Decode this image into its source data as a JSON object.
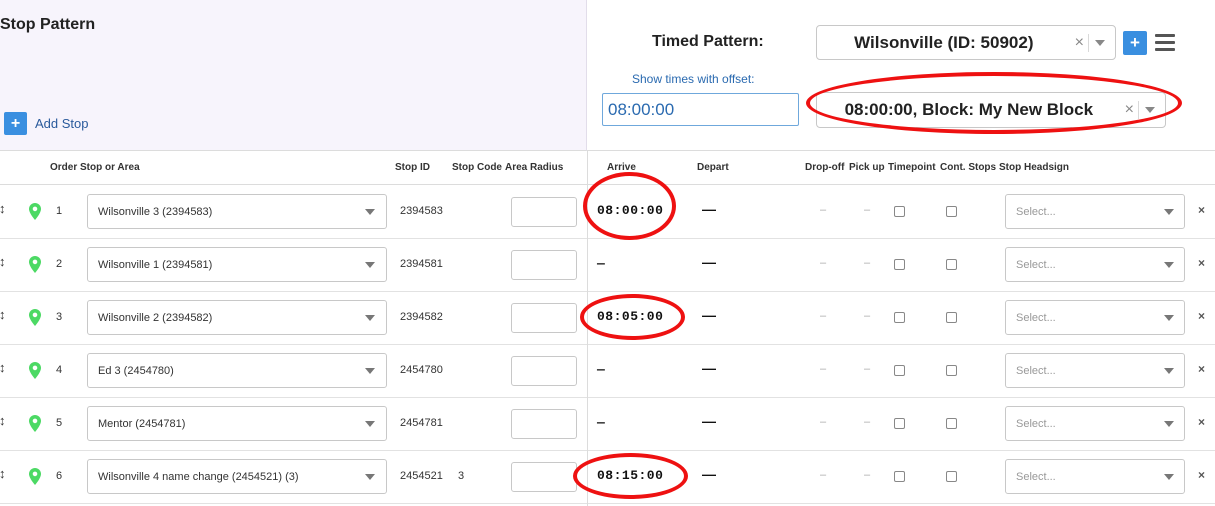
{
  "header": {
    "title": "Stop Pattern",
    "add_stop_label": "Add Stop",
    "add_icon_glyph": "+",
    "timed_pattern_label": "Timed Pattern:",
    "timed_pattern_value": "Wilsonville (ID: 50902)",
    "offset_label": "Show times with offset:",
    "offset_value": "08:00:00",
    "block_value": "08:00:00, Block: My New Block",
    "clear_glyph": "×"
  },
  "columns": {
    "order": "Order",
    "stop": "Stop or Area",
    "stop_id": "Stop ID",
    "stop_code": "Stop Code",
    "area_radius": "Area Radius",
    "arrive": "Arrive",
    "depart": "Depart",
    "dropoff": "Drop-off",
    "pickup": "Pick up",
    "timepoint": "Timepoint",
    "cont_stops": "Cont. Stops",
    "headsign": "Stop Headsign"
  },
  "glyphs": {
    "drag": "↕",
    "remove": "×",
    "dash_long": "—",
    "dash_short": "–"
  },
  "headsign_placeholder": "Select...",
  "icons": [
    "drag-handle-icon",
    "map-pin-icon",
    "plus-icon",
    "menu-icon",
    "clear-icon",
    "chevron-down-icon",
    "remove-icon"
  ],
  "colors": {
    "accent_blue": "#3a8fe0",
    "pin_green": "#4cd964",
    "annotation_red": "#e11111",
    "link_blue": "#2a6ab0"
  },
  "rows": [
    {
      "order": "1",
      "stop": "Wilsonville 3 (2394583)",
      "stop_id": "2394583",
      "stop_code": "",
      "arrive": "08:00:00",
      "depart": "—"
    },
    {
      "order": "2",
      "stop": "Wilsonville 1 (2394581)",
      "stop_id": "2394581",
      "stop_code": "",
      "arrive": "—",
      "depart": "—"
    },
    {
      "order": "3",
      "stop": "Wilsonville 2 (2394582)",
      "stop_id": "2394582",
      "stop_code": "",
      "arrive": "08:05:00",
      "depart": "—"
    },
    {
      "order": "4",
      "stop": "Ed 3 (2454780)",
      "stop_id": "2454780",
      "stop_code": "",
      "arrive": "—",
      "depart": "—"
    },
    {
      "order": "5",
      "stop": "Mentor (2454781)",
      "stop_id": "2454781",
      "stop_code": "",
      "arrive": "—",
      "depart": "—"
    },
    {
      "order": "6",
      "stop": "Wilsonville 4 name change (2454521) (3)",
      "stop_id": "2454521",
      "stop_code": "3",
      "arrive": "08:15:00",
      "depart": "—"
    }
  ]
}
